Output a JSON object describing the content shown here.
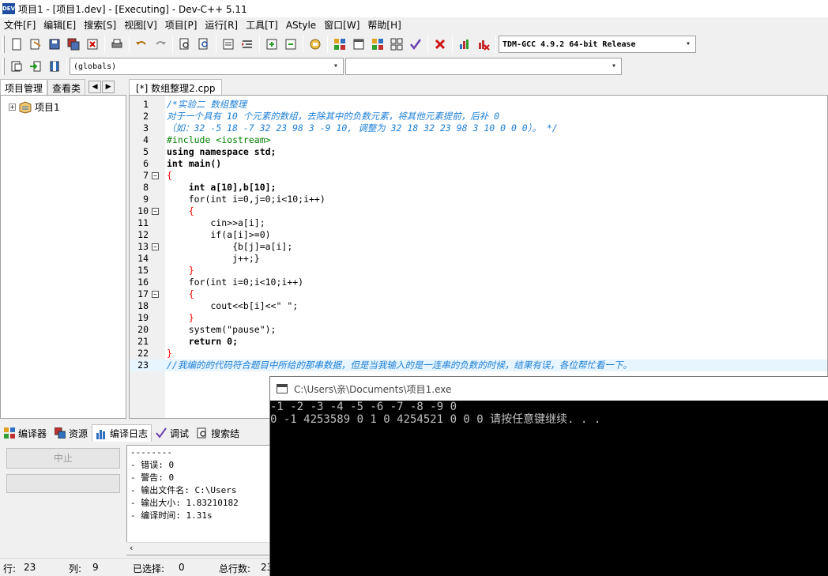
{
  "window": {
    "title": "项目1 - [项目1.dev] - [Executing] - Dev-C++ 5.11",
    "app_icon_text": "DEV"
  },
  "menu": [
    "文件[F]",
    "编辑[E]",
    "搜索[S]",
    "视图[V]",
    "项目[P]",
    "运行[R]",
    "工具[T]",
    "AStyle",
    "窗口[W]",
    "帮助[H]"
  ],
  "toolbar": {
    "compiler_select": "TDM-GCC 4.9.2 64-bit Release",
    "scope_select": "(globals)",
    "function_select": ""
  },
  "left_panel": {
    "tabs": [
      "项目管理",
      "查看类"
    ],
    "tree_root": "项目1"
  },
  "editor": {
    "tab_label": "[*] 数组整理2.cpp",
    "line_numbers": [
      "1",
      "2",
      "3",
      "4",
      "5",
      "6",
      "7",
      "8",
      "9",
      "10",
      "11",
      "12",
      "13",
      "14",
      "15",
      "16",
      "17",
      "18",
      "19",
      "20",
      "21",
      "22",
      "23"
    ],
    "lines": [
      "/*实验二 数组整理",
      "对于一个具有 10 个元素的数组，去除其中的负数元素，将其他元素提前，后补 0",
      "（如：32 -5 18 -7 32 23 98 3 -9 10, 调整为 32 18 32 23 98 3 10 0 0 0）。 */",
      "#include <iostream>",
      "using namespace std;",
      "int main()",
      "{",
      "    int a[10],b[10];",
      "    for(int i=0,j=0;i<10;i++)",
      "    {",
      "        cin>>a[i];",
      "        if(a[i]>=0)",
      "            {b[j]=a[i];",
      "            j++;}",
      "    }",
      "    for(int i=0;i<10;i++)",
      "    {",
      "        cout<<b[i]<<\" \";",
      "    }",
      "    system(\"pause\");",
      "    return 0;",
      "}",
      "//我编的的代码符合题目中所给的那串数据，但是当我输入的是一连串的负数的时候，结果有误，各位帮忙看一下。"
    ]
  },
  "bottom_panel": {
    "tabs": [
      "编译器",
      "资源",
      "编译日志",
      "调试",
      "搜索结"
    ],
    "abort_button": "中止",
    "log_lines": [
      "--------",
      "- 错误: 0",
      "- 警告: 0",
      "- 输出文件名: C:\\Users",
      "- 输出大小: 1.83210182",
      "- 编译时间: 1.31s"
    ]
  },
  "status_bar": {
    "row_label": "行:",
    "row_value": "23",
    "col_label": "列:",
    "col_value": "9",
    "sel_label": "已选择:",
    "sel_value": "0",
    "total_label": "总行数:",
    "total_value": "23"
  },
  "console": {
    "title": "C:\\Users\\亲\\Documents\\项目1.exe",
    "lines": [
      "-1 -2 -3 -4 -5 -6 -7 -8 -9 0",
      "0 -1 4253589 0 1 0 4254521 0 0 0 请按任意键继续. . ."
    ]
  }
}
